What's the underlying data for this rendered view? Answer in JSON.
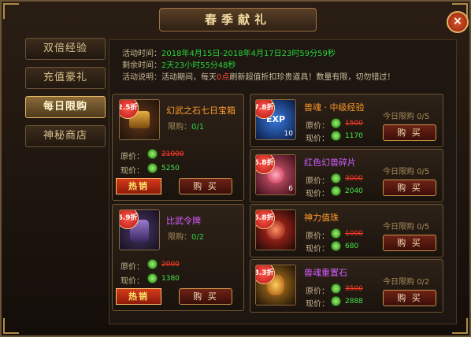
{
  "window": {
    "title": "春季献礼",
    "close_glyph": "×"
  },
  "sidebar": {
    "items": [
      "双倍经验",
      "充值豪礼",
      "每日限购",
      "神秘商店"
    ],
    "active_index": 2
  },
  "info": {
    "time_label": "活动时间：",
    "time_value": "2018年4月15日-2018年4月17日23时59分59秒",
    "remain_label": "剩余时间：",
    "remain_value": "2天23小时55分48秒",
    "desc_label": "活动说明：",
    "desc_text_1": "活动期间，每天",
    "desc_highlight": "0点",
    "desc_text_2": "刷新超值折扣珍贵道具！数量有限，切勿错过！"
  },
  "labels": {
    "orig_price": "原价：",
    "cur_price": "现价：",
    "buy": "购 买",
    "hot": "热销",
    "limit_prefix": "限购："
  },
  "items": [
    {
      "name": "幻武之石七日宝箱",
      "discount": "2.5折",
      "limit": "0/1",
      "orig": "21000",
      "price": "5250",
      "hot": true
    },
    {
      "name": "比武令牌",
      "discount": "6.9折",
      "limit": "0/2",
      "orig": "2000",
      "price": "1380",
      "hot": true
    },
    {
      "name": "兽魂 · 中级经验",
      "discount": "7.8折",
      "qty": "10",
      "daily_label": "今日限购",
      "daily": "0/5",
      "orig": "1500",
      "price": "1170"
    },
    {
      "name": "红色幻兽碎片",
      "discount": "6.8折",
      "qty": "6",
      "daily_label": "今日限购",
      "daily": "0/5",
      "orig": "3000",
      "price": "2040"
    },
    {
      "name": "神力值珠",
      "discount": "6.8折",
      "qty": "",
      "daily_label": "今日限购",
      "daily": "0/5",
      "orig": "1000",
      "price": "680"
    },
    {
      "name": "兽魂重置石",
      "discount": "8.3折",
      "qty": "",
      "daily_label": "今日限购",
      "daily": "0/2",
      "orig": "3500",
      "price": "2888"
    }
  ],
  "exp_icon_text": "EXP"
}
